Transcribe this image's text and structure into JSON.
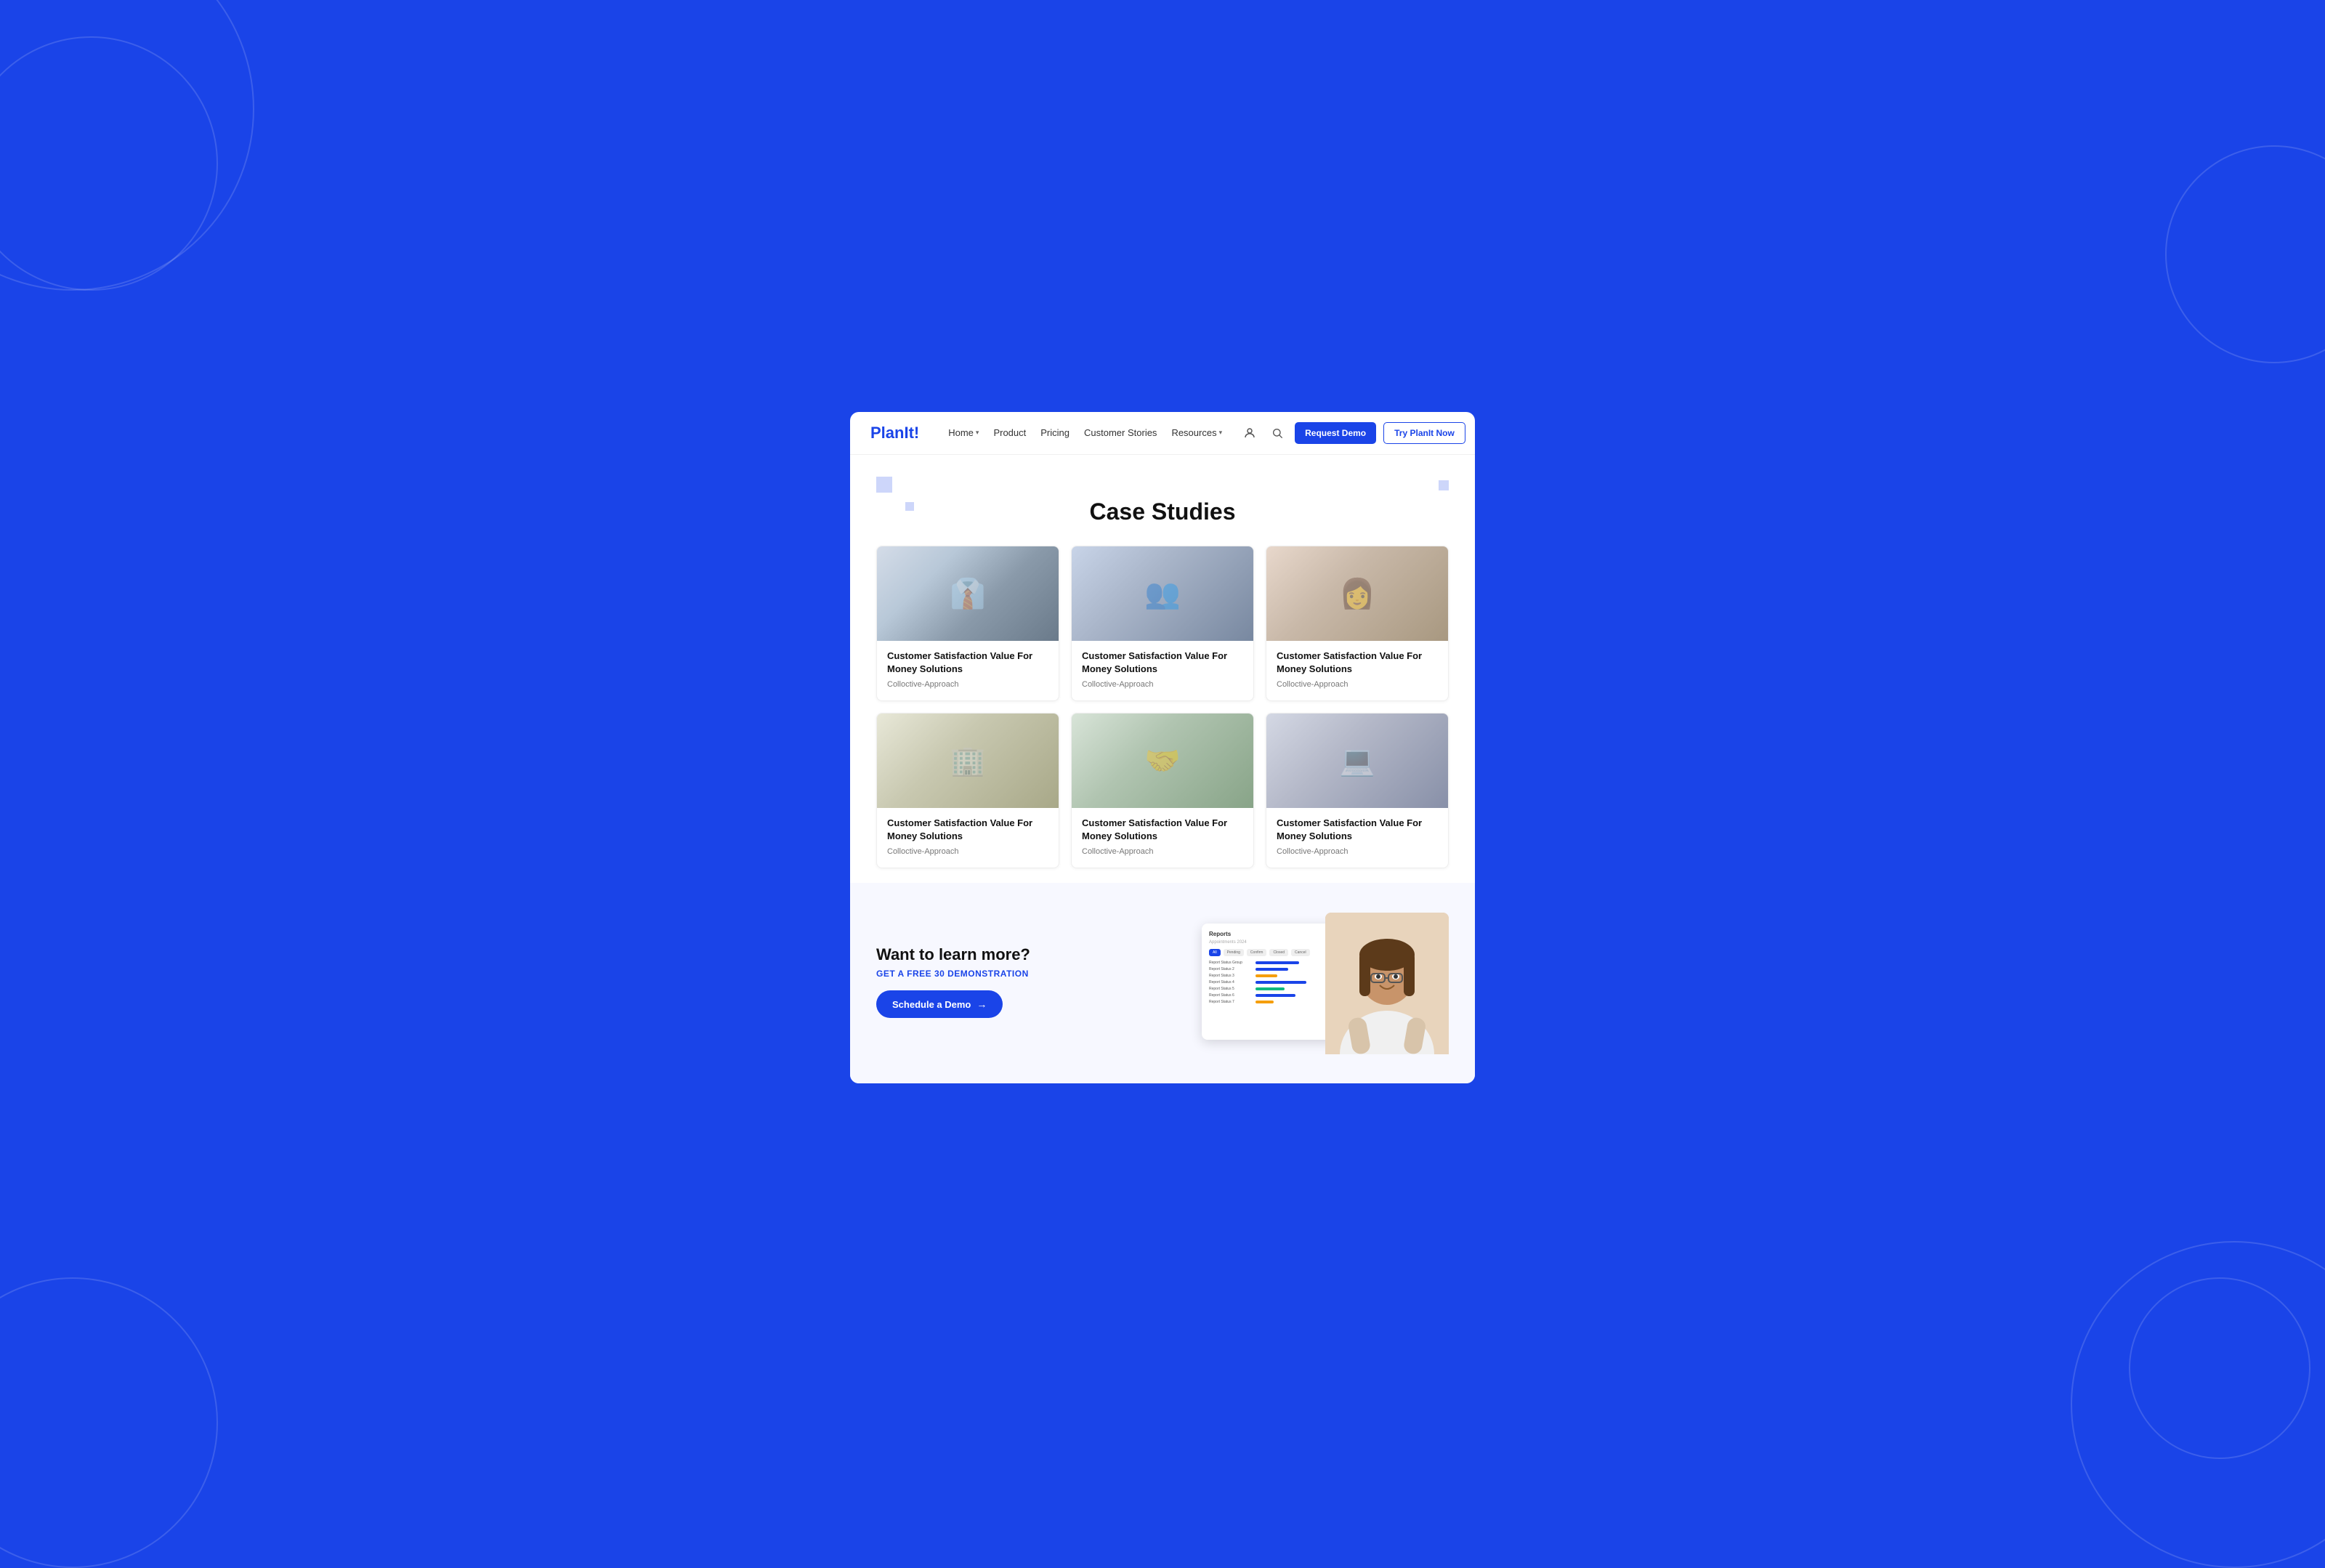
{
  "background": {
    "color": "#1a44e8"
  },
  "navbar": {
    "logo_text": "PlanIt",
    "logo_exclamation": "!",
    "nav_links": [
      {
        "label": "Home",
        "has_dropdown": true
      },
      {
        "label": "Product",
        "has_dropdown": false
      },
      {
        "label": "Pricing",
        "has_dropdown": false
      },
      {
        "label": "Customer Stories",
        "has_dropdown": false
      },
      {
        "label": "Resources",
        "has_dropdown": true
      }
    ],
    "btn_request_demo": "Request Demo",
    "btn_try_planit": "Try PlanIt Now"
  },
  "page": {
    "title": "Case Studies"
  },
  "cards": [
    {
      "id": 1,
      "img_class": "img-biz-man",
      "title": "Customer Satisfaction Value For Money Solutions",
      "subtitle": "Colloctive-Approach"
    },
    {
      "id": 2,
      "img_class": "img-team",
      "title": "Customer Satisfaction Value For Money Solutions",
      "subtitle": "Colloctive-Approach"
    },
    {
      "id": 3,
      "img_class": "img-woman",
      "title": "Customer Satisfaction Value For Money Solutions",
      "subtitle": "Colloctive-Approach"
    },
    {
      "id": 4,
      "img_class": "img-office",
      "title": "Customer Satisfaction Value For Money Solutions",
      "subtitle": "Colloctive-Approach"
    },
    {
      "id": 5,
      "img_class": "img-meeting",
      "title": "Customer Satisfaction Value For Money Solutions",
      "subtitle": "Colloctive-Approach"
    },
    {
      "id": 6,
      "img_class": "img-laptop",
      "title": "Customer Satisfaction Value For Money Solutions",
      "subtitle": "Colloctive-Approach"
    }
  ],
  "cta": {
    "title": "Want to learn more?",
    "subtitle": "GET A FREE 30 DEMONSTRATION",
    "btn_label": "Schedule a Demo",
    "btn_arrow": "→"
  },
  "dashboard": {
    "header": "Reports",
    "sub": "Appointments 2024",
    "tabs": [
      "All",
      "Pending",
      "Confirm",
      "Closed",
      "Cancel"
    ],
    "rows": [
      {
        "label": "Report Status Group",
        "width": 60,
        "type": "blue"
      },
      {
        "label": "Report Status 2",
        "width": 45,
        "type": "blue"
      },
      {
        "label": "Report Status 3",
        "width": 30,
        "type": "orange"
      },
      {
        "label": "Report Status 4",
        "width": 70,
        "type": "blue"
      },
      {
        "label": "Report Status 5",
        "width": 40,
        "type": "green"
      },
      {
        "label": "Report Status 6",
        "width": 55,
        "type": "blue"
      },
      {
        "label": "Report Status 7",
        "width": 25,
        "type": "orange"
      }
    ]
  }
}
